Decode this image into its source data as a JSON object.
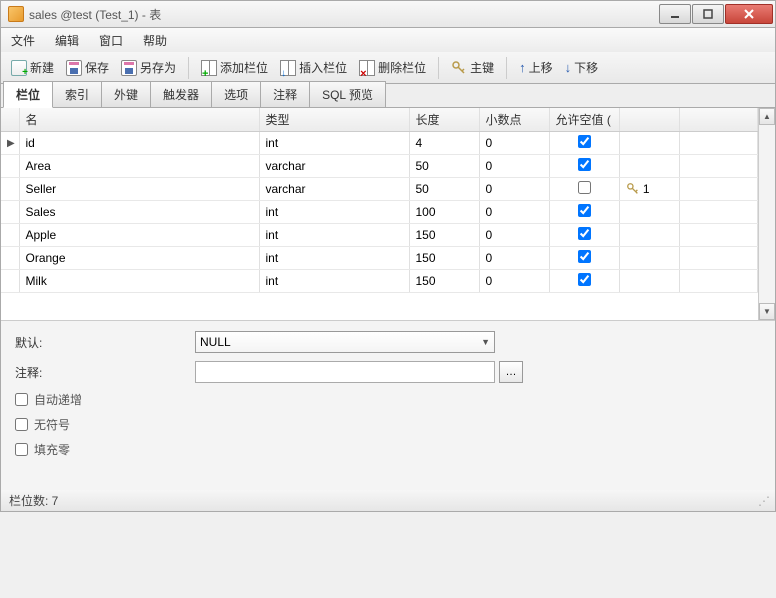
{
  "window": {
    "title": "sales @test (Test_1) - 表"
  },
  "menu": {
    "file": "文件",
    "edit": "编辑",
    "window": "窗口",
    "help": "帮助"
  },
  "toolbar": {
    "new": "新建",
    "save": "保存",
    "saveas": "另存为",
    "addcol": "添加栏位",
    "inscol": "插入栏位",
    "delcol": "删除栏位",
    "pkey": "主键",
    "moveup": "上移",
    "movedown": "下移"
  },
  "tabs": {
    "cols": "栏位",
    "index": "索引",
    "fkey": "外键",
    "trigger": "触发器",
    "options": "选项",
    "comment": "注释",
    "sql": "SQL 预览"
  },
  "headers": {
    "name": "名",
    "type": "类型",
    "length": "长度",
    "decimal": "小数点",
    "nullable": "允许空值 ("
  },
  "rows": [
    {
      "name": "id",
      "type": "int",
      "len": "4",
      "dec": "0",
      "null": true,
      "key": ""
    },
    {
      "name": "Area",
      "type": "varchar",
      "len": "50",
      "dec": "0",
      "null": true,
      "key": ""
    },
    {
      "name": "Seller",
      "type": "varchar",
      "len": "50",
      "dec": "0",
      "null": false,
      "key": "1"
    },
    {
      "name": "Sales",
      "type": "int",
      "len": "100",
      "dec": "0",
      "null": true,
      "key": ""
    },
    {
      "name": "Apple",
      "type": "int",
      "len": "150",
      "dec": "0",
      "null": true,
      "key": ""
    },
    {
      "name": "Orange",
      "type": "int",
      "len": "150",
      "dec": "0",
      "null": true,
      "key": ""
    },
    {
      "name": "Milk",
      "type": "int",
      "len": "150",
      "dec": "0",
      "null": true,
      "key": ""
    }
  ],
  "props": {
    "default_label": "默认:",
    "default_value": "NULL",
    "comment_label": "注释:",
    "comment_value": "",
    "autoinc": "自动递增",
    "unsigned": "无符号",
    "zerofill": "填充零"
  },
  "statusbar": {
    "text": "栏位数: 7"
  }
}
